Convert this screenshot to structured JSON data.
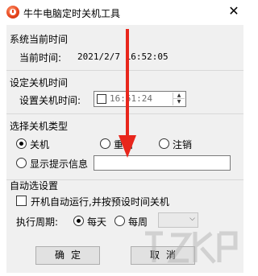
{
  "window": {
    "title": "牛牛电脑定时关机工具",
    "close_glyph": "✕"
  },
  "current_time": {
    "section_label": "系统当前时间",
    "label": "当前时间:",
    "value": "2021/2/7 16:52:05"
  },
  "set_shutdown": {
    "section_label": "设定关机时间",
    "label": "设置关机时间:",
    "time_value": "16:51:24",
    "enabled": false
  },
  "shutdown_type": {
    "section_label": "选择关机类型",
    "options": [
      {
        "label": "关机",
        "checked": true
      },
      {
        "label": "重启",
        "checked": false
      },
      {
        "label": "注销",
        "checked": false
      },
      {
        "label": "显示提示信息",
        "checked": false
      }
    ],
    "message_input": ""
  },
  "auto_options": {
    "section_label": "自动选设置",
    "autorun_label": "开机自动运行,并按预设时间关机",
    "autorun_checked": false,
    "period_label": "执行周期:",
    "period_options": [
      {
        "label": "每天",
        "checked": true
      },
      {
        "label": "每周",
        "checked": false
      }
    ],
    "weekday_value": ""
  },
  "buttons": {
    "ok": "确定",
    "cancel": "取消"
  },
  "annotation": {
    "color": "#e8261c"
  },
  "icons": {
    "app": "clock-icon",
    "close": "close-icon",
    "spin_up": "spin-up-icon",
    "spin_down": "spin-down-icon",
    "combo": "chevron-down-icon"
  }
}
